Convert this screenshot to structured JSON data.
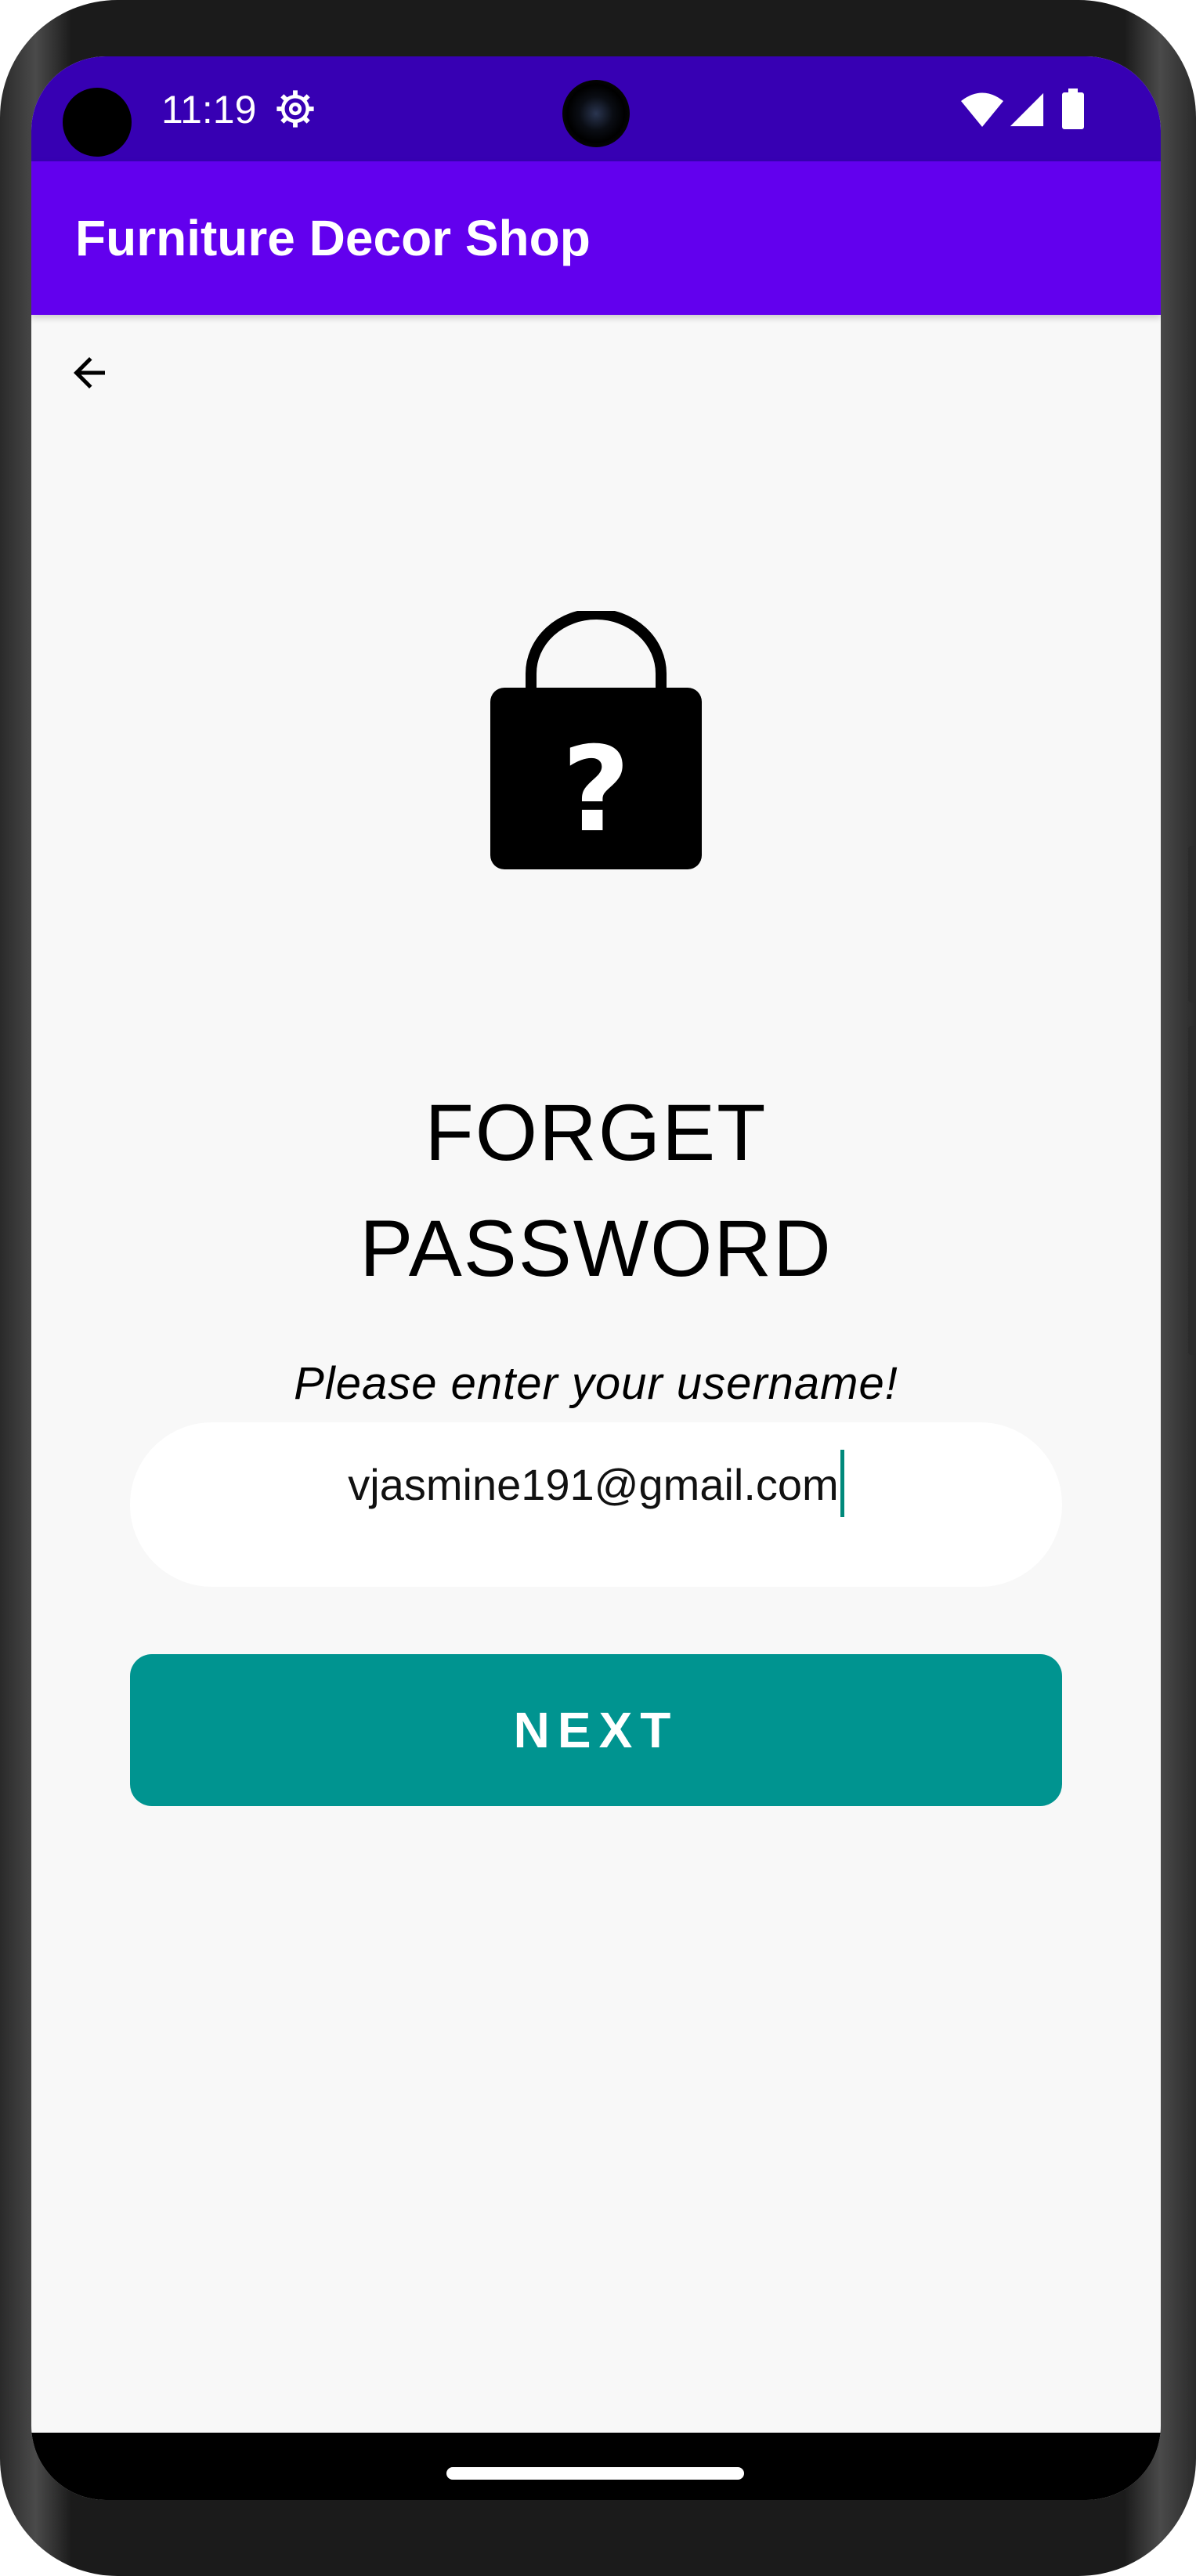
{
  "status_bar": {
    "time": "11:19",
    "icons": [
      "settings-icon",
      "wifi-icon",
      "signal-icon",
      "battery-icon"
    ]
  },
  "app_bar": {
    "title": "Furniture Decor Shop",
    "background_color": "#6200ee",
    "status_color": "#3700b3"
  },
  "navigation": {
    "back_icon": "arrow-back-icon"
  },
  "main": {
    "illustration_icon": "lock-question-icon",
    "heading_line1": "FORGET",
    "heading_line2": "PASSWORD",
    "subtitle": "Please enter your username!",
    "username_value": "vjasmine191@gmail.com",
    "next_label": "NEXT",
    "accent_color": "#009490"
  }
}
